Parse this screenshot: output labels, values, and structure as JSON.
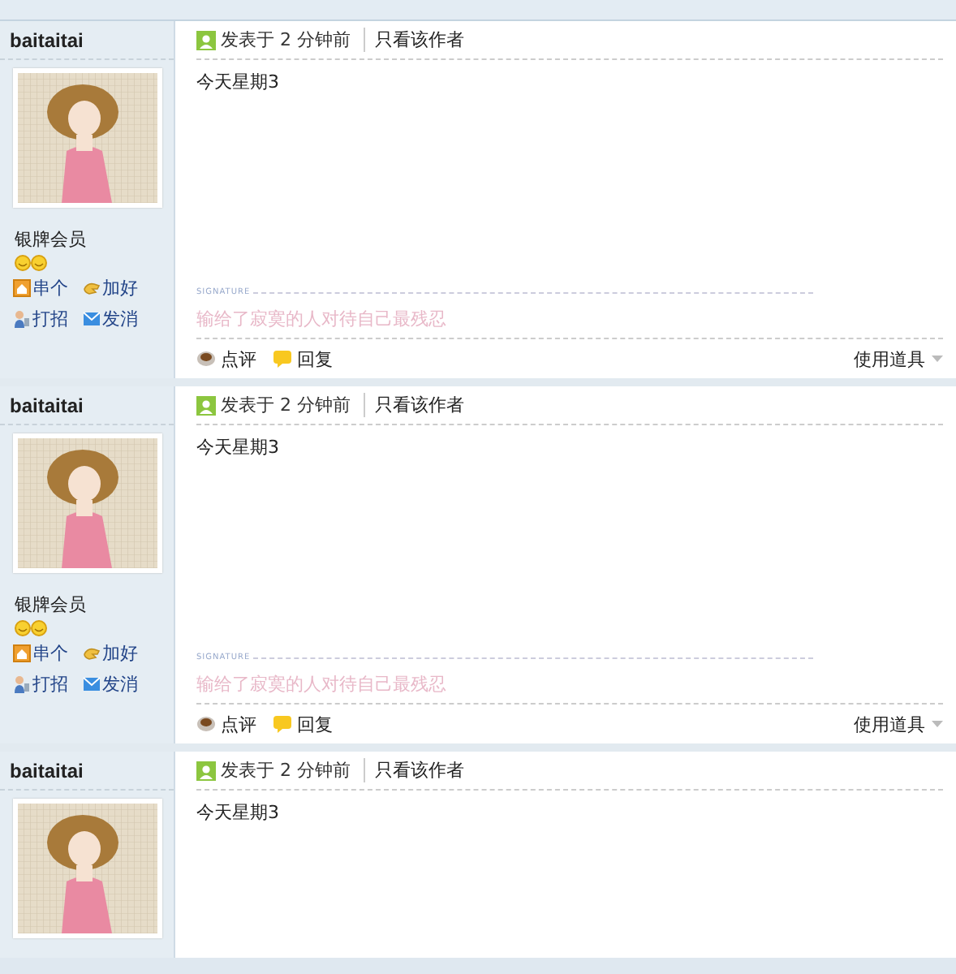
{
  "posts": [
    {
      "author": "baitaitai",
      "rank": "银牌会员",
      "user_links": [
        "串个",
        "加好",
        "打招",
        "发消"
      ],
      "posted": "发表于 2 分钟前",
      "author_only": "只看该作者",
      "body": "今天星期3",
      "signature_label": "SIGNATURE",
      "signature": "输给了寂寞的人对待自己最残忍",
      "actions": [
        "点评",
        "回复"
      ],
      "tools": "使用道具"
    },
    {
      "author": "baitaitai",
      "rank": "银牌会员",
      "user_links": [
        "串个",
        "加好",
        "打招",
        "发消"
      ],
      "posted": "发表于 2 分钟前",
      "author_only": "只看该作者",
      "body": "今天星期3",
      "signature_label": "SIGNATURE",
      "signature": "输给了寂寞的人对待自己最残忍",
      "actions": [
        "点评",
        "回复"
      ],
      "tools": "使用道具"
    },
    {
      "author": "baitaitai",
      "posted": "发表于 2 分钟前",
      "author_only": "只看该作者",
      "body": "今天星期3"
    }
  ]
}
